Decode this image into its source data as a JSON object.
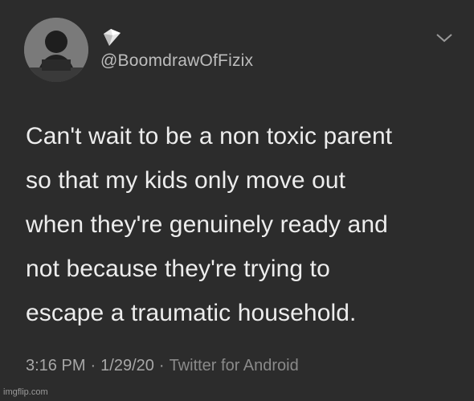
{
  "tweet": {
    "handle": "@BoomdrawOfFizix",
    "text": "Can't wait to be a non toxic parent\nso that my kids only move out\nwhen they're genuinely ready and\nnot because they're trying to\nescape a traumatic household.",
    "time": "3:16 PM",
    "date": "1/29/20",
    "source": "Twitter for Android",
    "separator": "·"
  },
  "watermark": "imgflip.com",
  "icons": {
    "avatar": "profile-photo",
    "badge": "shard-emoji-icon",
    "menu": "chevron-down-icon"
  },
  "colors": {
    "background": "#2c2c2c",
    "text": "#ededed",
    "muted": "#9e9e9e"
  }
}
